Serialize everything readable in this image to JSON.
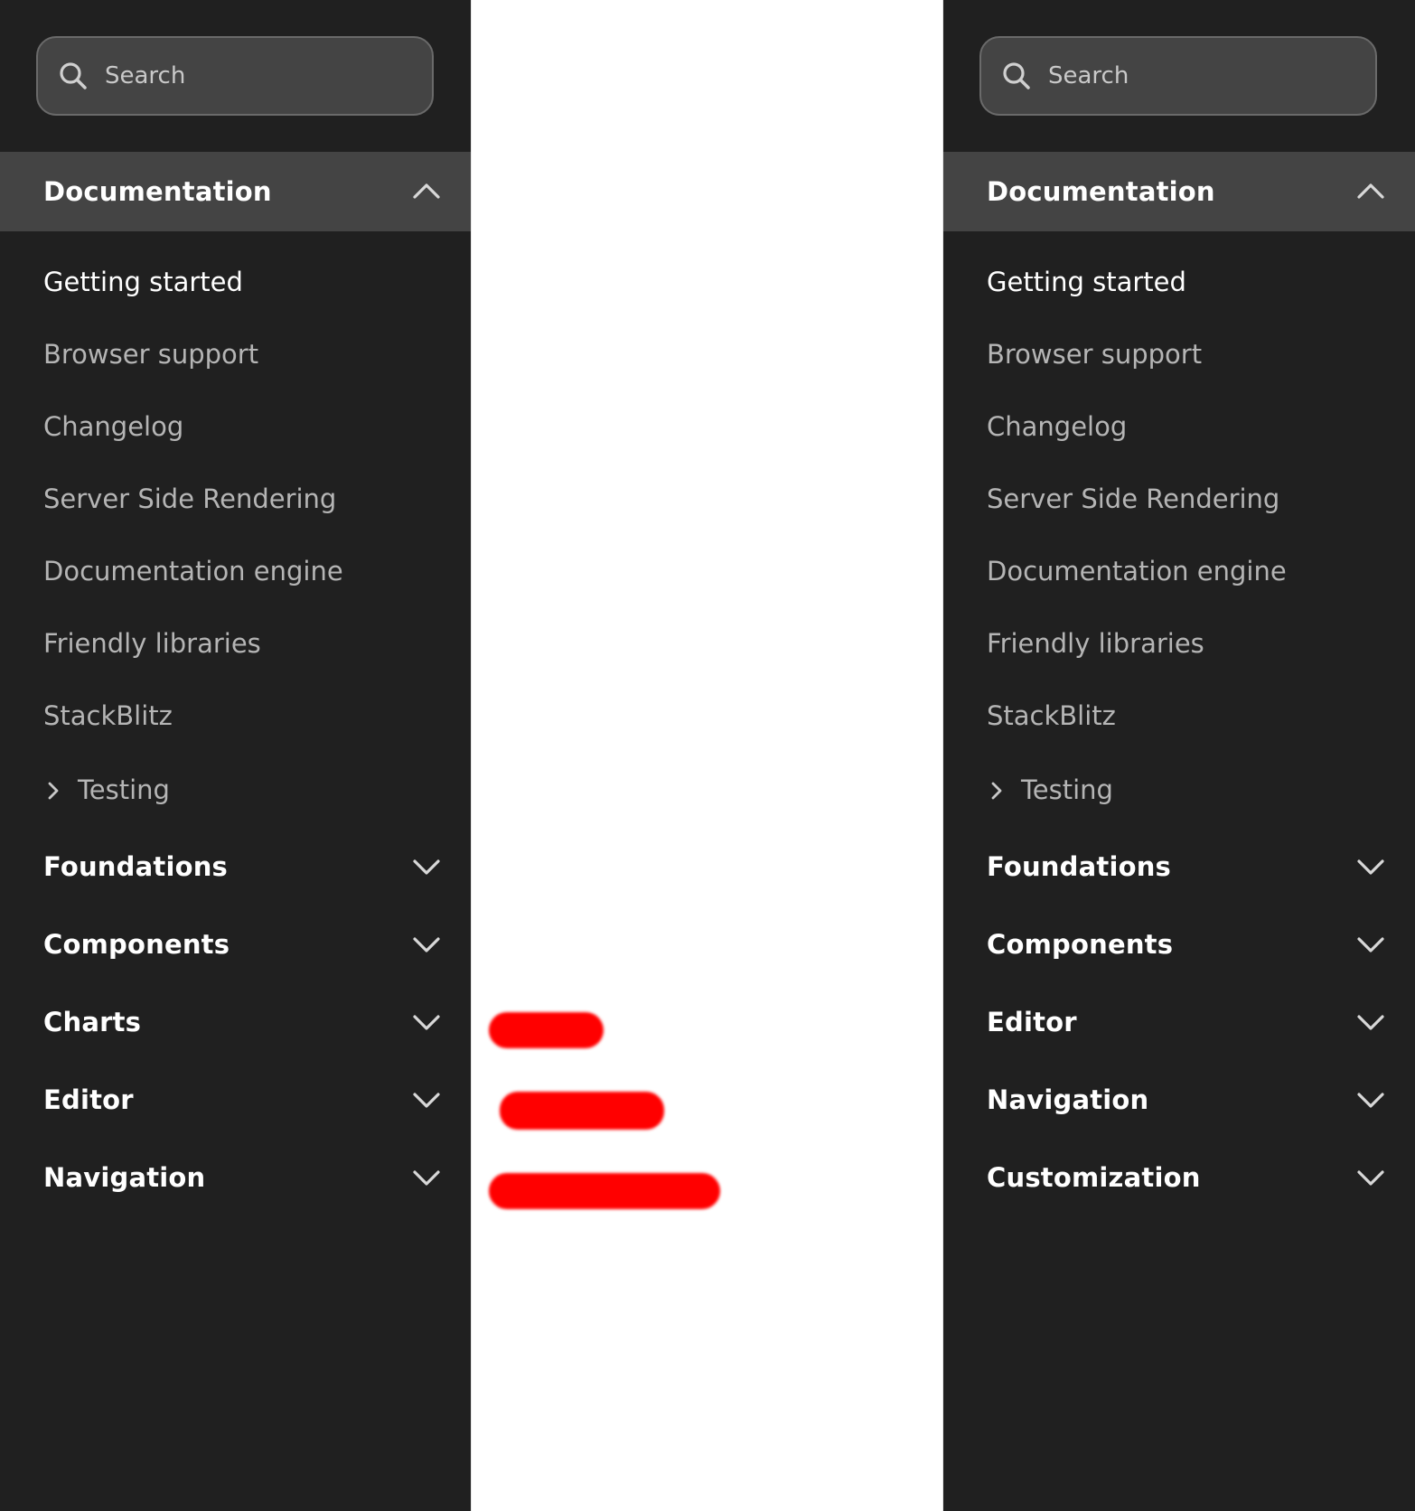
{
  "left_sidebar": {
    "search_placeholder": "Search",
    "active_section": "Documentation",
    "items": [
      "Getting started",
      "Browser support",
      "Changelog",
      "Server Side Rendering",
      "Documentation engine",
      "Friendly libraries",
      "StackBlitz"
    ],
    "subgroup": "Testing",
    "sections": [
      "Foundations",
      "Components",
      "Charts",
      "Editor",
      "Navigation"
    ]
  },
  "right_sidebar": {
    "search_placeholder": "Search",
    "active_section": "Documentation",
    "items": [
      "Getting started",
      "Browser support",
      "Changelog",
      "Server Side Rendering",
      "Documentation engine",
      "Friendly libraries",
      "StackBlitz"
    ],
    "subgroup": "Testing",
    "sections": [
      "Foundations",
      "Components",
      "Editor",
      "Navigation",
      "Customization"
    ]
  },
  "colors": {
    "sidebar_bg": "#202020",
    "active_bg": "#444444",
    "redaction": "#ff0000"
  }
}
